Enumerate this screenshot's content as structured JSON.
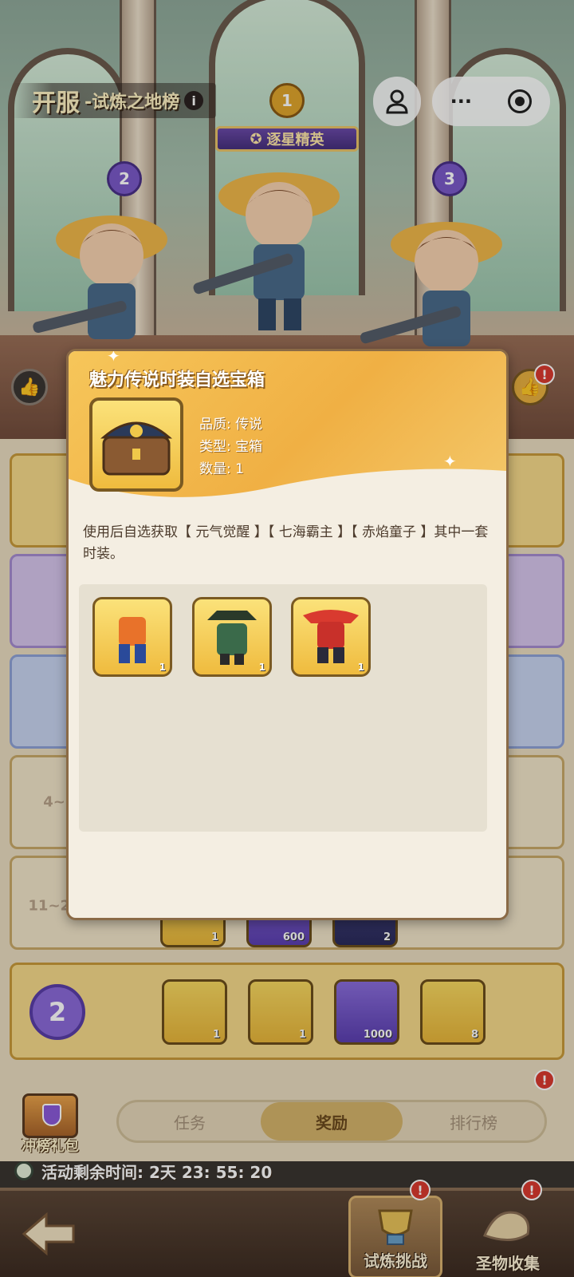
{
  "header": {
    "title_main": "开服",
    "title_sub": "-试炼之地榜",
    "info_icon": "i",
    "rank1": "1",
    "rank2": "2",
    "rank3": "3",
    "elite_label": "逐星精英",
    "more_label": "···"
  },
  "popup": {
    "title": "魅力传说时装自选宝箱",
    "quality": "品质: 传说",
    "type": "类型: 宝箱",
    "quantity": "数量: 1",
    "description": "使用后自选获取【 元气觉醒 】【 七海霸主 】【 赤焰童子 】其中一套时装。",
    "costumes": [
      {
        "name": "元气觉醒",
        "count": "1"
      },
      {
        "name": "七海霸主",
        "count": "1"
      },
      {
        "name": "赤焰童子",
        "count": "1"
      }
    ]
  },
  "list": {
    "row4_label": "4~",
    "row5_label": "11~20",
    "row5_items": [
      {
        "count": "1"
      },
      {
        "count": "600"
      },
      {
        "count": "2"
      }
    ],
    "my_rank": "2",
    "my_items": [
      {
        "count": "1"
      },
      {
        "count": "1"
      },
      {
        "count": "1000"
      },
      {
        "count": "8"
      }
    ]
  },
  "gift_pack_label": "冲榜礼包",
  "tabs": [
    {
      "label": "任务"
    },
    {
      "label": "奖励"
    },
    {
      "label": "排行榜"
    }
  ],
  "timer_text": "活动剩余时间: 2天 23: 55: 20",
  "bottom_nav": {
    "trial_label": "试炼挑战",
    "relic_label": "圣物收集"
  },
  "excl": "!",
  "colors": {
    "gold": "#f0b044",
    "purple": "#6a4aa8",
    "alert": "#d93a2f"
  }
}
